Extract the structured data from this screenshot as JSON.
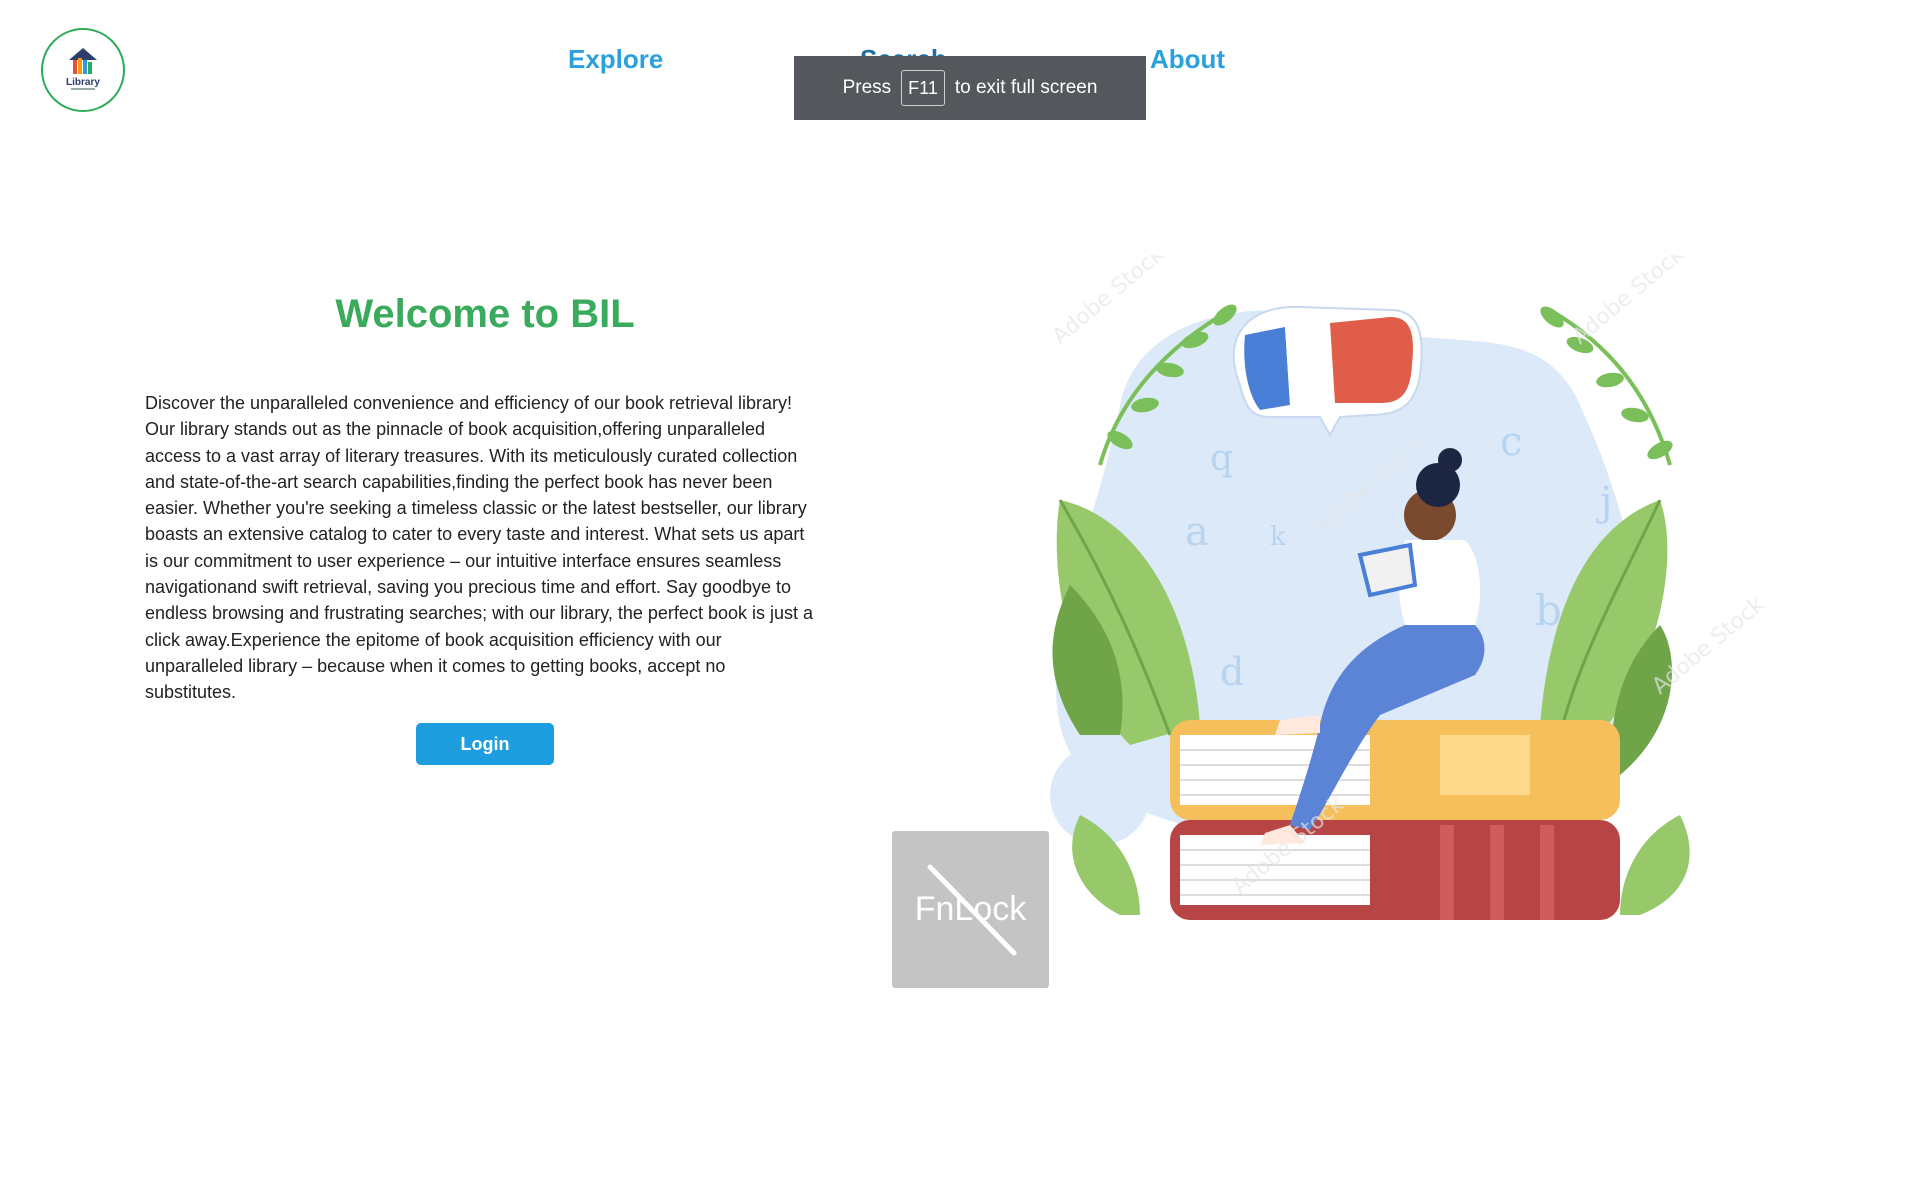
{
  "header": {
    "logo_text": "Library",
    "nav": [
      {
        "label": "Explore"
      },
      {
        "label": "Search"
      },
      {
        "label": "About"
      }
    ]
  },
  "fullscreen_toast": {
    "prefix": "Press",
    "key": "F11",
    "suffix": "to exit full screen"
  },
  "hero": {
    "title": "Welcome to BIL",
    "description": "Discover the unparalleled convenience and efficiency of our book retrieval library! Our library stands out as the pinnacle of book acquisition,offering unparalleled access to a vast array of literary treasures. With its meticulously curated collection and state-of-the-art search capabilities,finding the perfect book has never been easier. Whether you're seeking a timeless classic or the latest bestseller, our library boasts an extensive catalog to cater to every taste and interest. What sets us apart is our commitment to user experience – our intuitive interface ensures seamless navigationand swift retrieval, saving you precious time and effort. Say goodbye to endless browsing and frustrating searches; with our library, the perfect book is just a click away.Experience the epitome of book acquisition efficiency with our unparalleled library – because when it comes to getting books, accept no substitutes.",
    "login_label": "Login"
  },
  "overlay": {
    "fnlock_label": "FnLock"
  },
  "colors": {
    "brand_green": "#3aaa5c",
    "nav_blue": "#2aa0dd",
    "button_blue": "#1e9ede",
    "toast_bg": "#54575b"
  }
}
